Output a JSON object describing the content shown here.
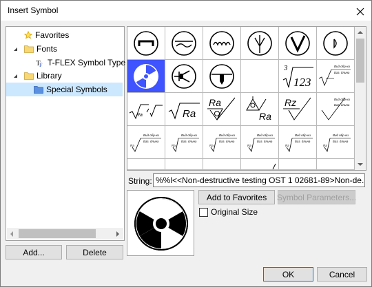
{
  "window": {
    "title": "Insert Symbol"
  },
  "tree": {
    "items": [
      {
        "label": "Favorites",
        "icon": "star-icon"
      },
      {
        "label": "Fonts",
        "icon": "folder-icon"
      },
      {
        "label": "T-FLEX Symbol Type A",
        "icon": "font-icon"
      },
      {
        "label": "Library",
        "icon": "folder-icon"
      },
      {
        "label": "Special Symbols",
        "icon": "blue-folder-icon"
      }
    ],
    "selected": "Special Symbols"
  },
  "buttons": {
    "add": "Add...",
    "delete": "Delete",
    "add_to_favorites": "Add to Favorites",
    "symbol_parameters": "Symbol Parameters...",
    "ok": "OK",
    "cancel": "Cancel"
  },
  "symbol_grid": {
    "selected_index": 6,
    "symbols": [
      "circle-bar",
      "circle-tilde",
      "circle-waves",
      "circle-trident",
      "circle-v",
      "circle-d",
      "radiation",
      "circle-triangle-arrow",
      "circle-t-join",
      "empty",
      "cube-root-123",
      "roughness-annotation",
      "root-ra-sketch",
      "root-ra",
      "ra-check",
      "ra-triangle-circle",
      "rz-check",
      "roughness-check",
      "roughness-small",
      "roughness-small",
      "roughness-small",
      "roughness-small",
      "roughness-small",
      "roughness-small"
    ],
    "glyph_text": {
      "root_small": "Ra",
      "ra": "Ra",
      "rz": "Rz",
      "cube_root_index": "3",
      "cube_root_value": "123",
      "tiny_top": "Вид обр-ки",
      "tiny_mid": "Баз. длина",
      "tiny_ra": "Ra"
    }
  },
  "string": {
    "label": "String:",
    "value": "%%l<<Non-destructive testing OST 1 02681-89>Non-de..."
  },
  "options": {
    "original_size_label": "Original Size",
    "original_size_checked": false
  }
}
